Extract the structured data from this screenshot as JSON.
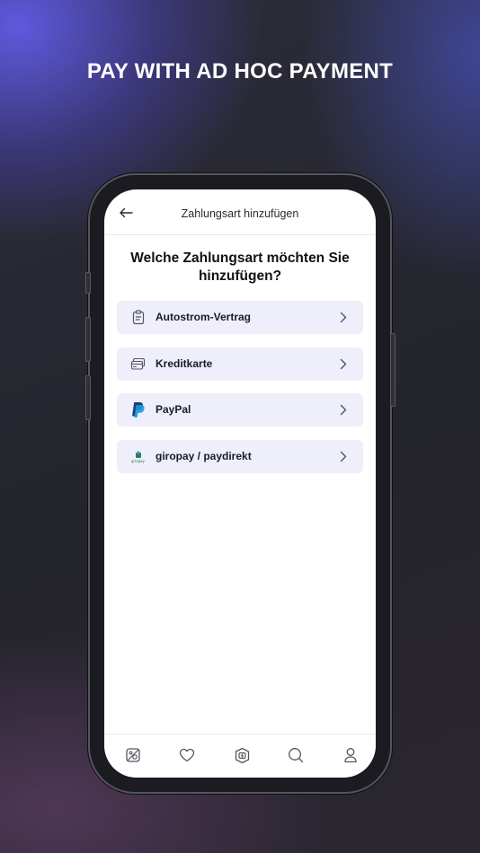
{
  "headline": "PAY WITH AD HOC PAYMENT",
  "screen": {
    "title": "Zahlungsart hinzufügen",
    "question": "Welche Zahlungsart möchten Sie hinzufügen?"
  },
  "options": [
    {
      "label": "Autostrom-Vertrag",
      "icon": "contract-clipboard-icon"
    },
    {
      "label": "Kreditkarte",
      "icon": "credit-card-icon"
    },
    {
      "label": "PayPal",
      "icon": "paypal-logo-icon"
    },
    {
      "label": "giropay / paydirekt",
      "icon": "giropay-logo-icon"
    }
  ],
  "giropay_logo_text": "giropay",
  "bottom_nav": [
    "map-icon",
    "heart-icon",
    "charging-station-icon",
    "search-icon",
    "profile-icon"
  ],
  "colors": {
    "option_bg": "#efeffb",
    "paypal_dark": "#253b80",
    "paypal_light": "#179bd7",
    "giropay_green": "#2a7e52"
  }
}
